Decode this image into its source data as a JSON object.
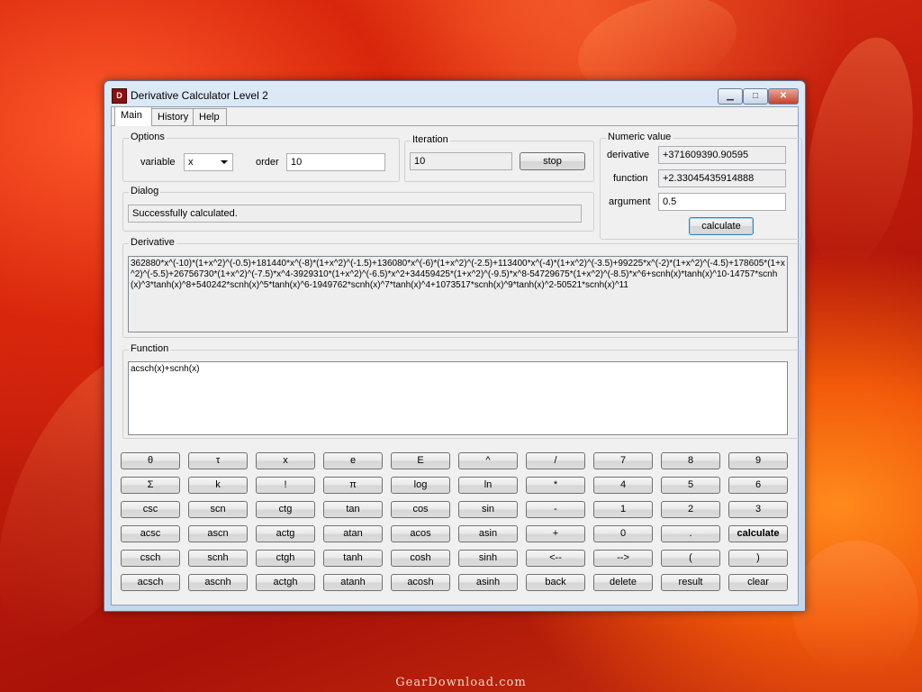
{
  "window": {
    "title": "Derivative Calculator Level 2",
    "icon_text": "D"
  },
  "tabs": [
    {
      "label": "Main"
    },
    {
      "label": "History"
    },
    {
      "label": "Help"
    }
  ],
  "options": {
    "title": "Options",
    "variable_label": "variable",
    "variable_value": "x",
    "order_label": "order",
    "order_value": "10"
  },
  "iteration": {
    "title": "Iteration",
    "value": "10",
    "stop_label": "stop"
  },
  "numeric": {
    "title": "Numeric value",
    "derivative_label": "derivative",
    "derivative_value": "+371609390.90595",
    "function_label": "function",
    "function_value": "+2.33045435914888",
    "argument_label": "argument",
    "argument_value": "0.5",
    "calculate_label": "calculate"
  },
  "dialog": {
    "title": "Dialog",
    "message": "Successfully calculated."
  },
  "derivative": {
    "title": "Derivative",
    "text": "362880*x^(-10)*(1+x^2)^(-0.5)+181440*x^(-8)*(1+x^2)^(-1.5)+136080*x^(-6)*(1+x^2)^(-2.5)+113400*x^(-4)*(1+x^2)^(-3.5)+99225*x^(-2)*(1+x^2)^(-4.5)+178605*(1+x^2)^(-5.5)+26756730*(1+x^2)^(-7.5)*x^4-3929310*(1+x^2)^(-6.5)*x^2+34459425*(1+x^2)^(-9.5)*x^8-54729675*(1+x^2)^(-8.5)*x^6+scnh(x)*tanh(x)^10-14757*scnh(x)^3*tanh(x)^8+540242*scnh(x)^5*tanh(x)^6-1949762*scnh(x)^7*tanh(x)^4+1073517*scnh(x)^9*tanh(x)^2-50521*scnh(x)^11"
  },
  "function": {
    "title": "Function",
    "text": "acsch(x)+scnh(x)"
  },
  "keypad": [
    [
      "θ",
      "τ",
      "x",
      "e",
      "E",
      "^",
      "/",
      "7",
      "8",
      "9"
    ],
    [
      "Σ",
      "k",
      "!",
      "π",
      "log",
      "ln",
      "*",
      "4",
      "5",
      "6"
    ],
    [
      "csc",
      "scn",
      "ctg",
      "tan",
      "cos",
      "sin",
      "-",
      "1",
      "2",
      "3"
    ],
    [
      "acsc",
      "ascn",
      "actg",
      "atan",
      "acos",
      "asin",
      "+",
      "0",
      ".",
      "calculate"
    ],
    [
      "csch",
      "scnh",
      "ctgh",
      "tanh",
      "cosh",
      "sinh",
      "<--",
      "-->",
      "(",
      ")"
    ],
    [
      "acsch",
      "ascnh",
      "actgh",
      "atanh",
      "acosh",
      "asinh",
      "back",
      "delete",
      "result",
      "clear"
    ]
  ],
  "watermark": "GearDownload.com"
}
